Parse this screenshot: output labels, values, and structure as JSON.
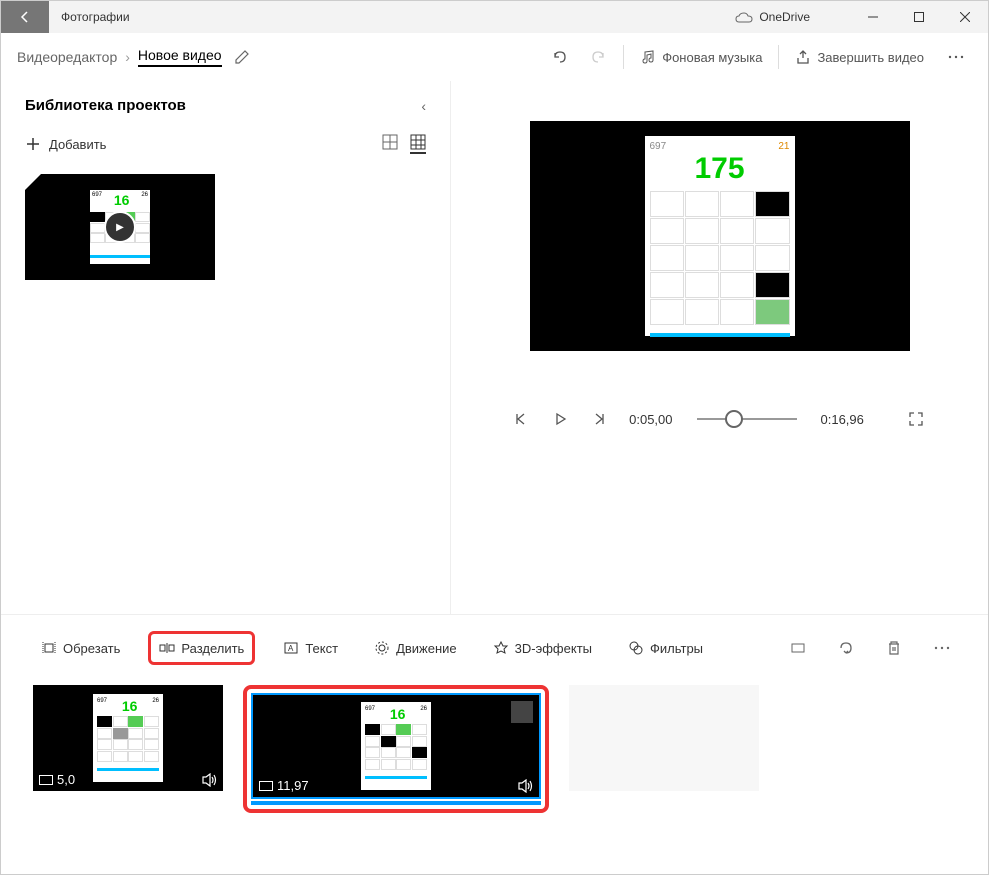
{
  "app": {
    "title": "Фотографии",
    "onedrive": "OneDrive"
  },
  "breadcrumb": {
    "editor": "Видеоредактор",
    "title": "Новое видео"
  },
  "topbar": {
    "music": "Фоновая музыка",
    "finish": "Завершить видео"
  },
  "library": {
    "title": "Библиотека проектов",
    "add": "Добавить"
  },
  "preview": {
    "score": "175",
    "left_num": "697",
    "right_num": "21"
  },
  "player": {
    "current": "0:05,00",
    "total": "0:16,96"
  },
  "toolbar": {
    "trim": "Обрезать",
    "split": "Разделить",
    "text": "Текст",
    "motion": "Движение",
    "effects": "3D-эффекты",
    "filters": "Фильтры"
  },
  "clips": {
    "clip1": {
      "duration": "5,0",
      "score": "16",
      "l": "697",
      "r": "26"
    },
    "clip2": {
      "duration": "11,97",
      "score": "16",
      "l": "697",
      "r": "26"
    }
  }
}
